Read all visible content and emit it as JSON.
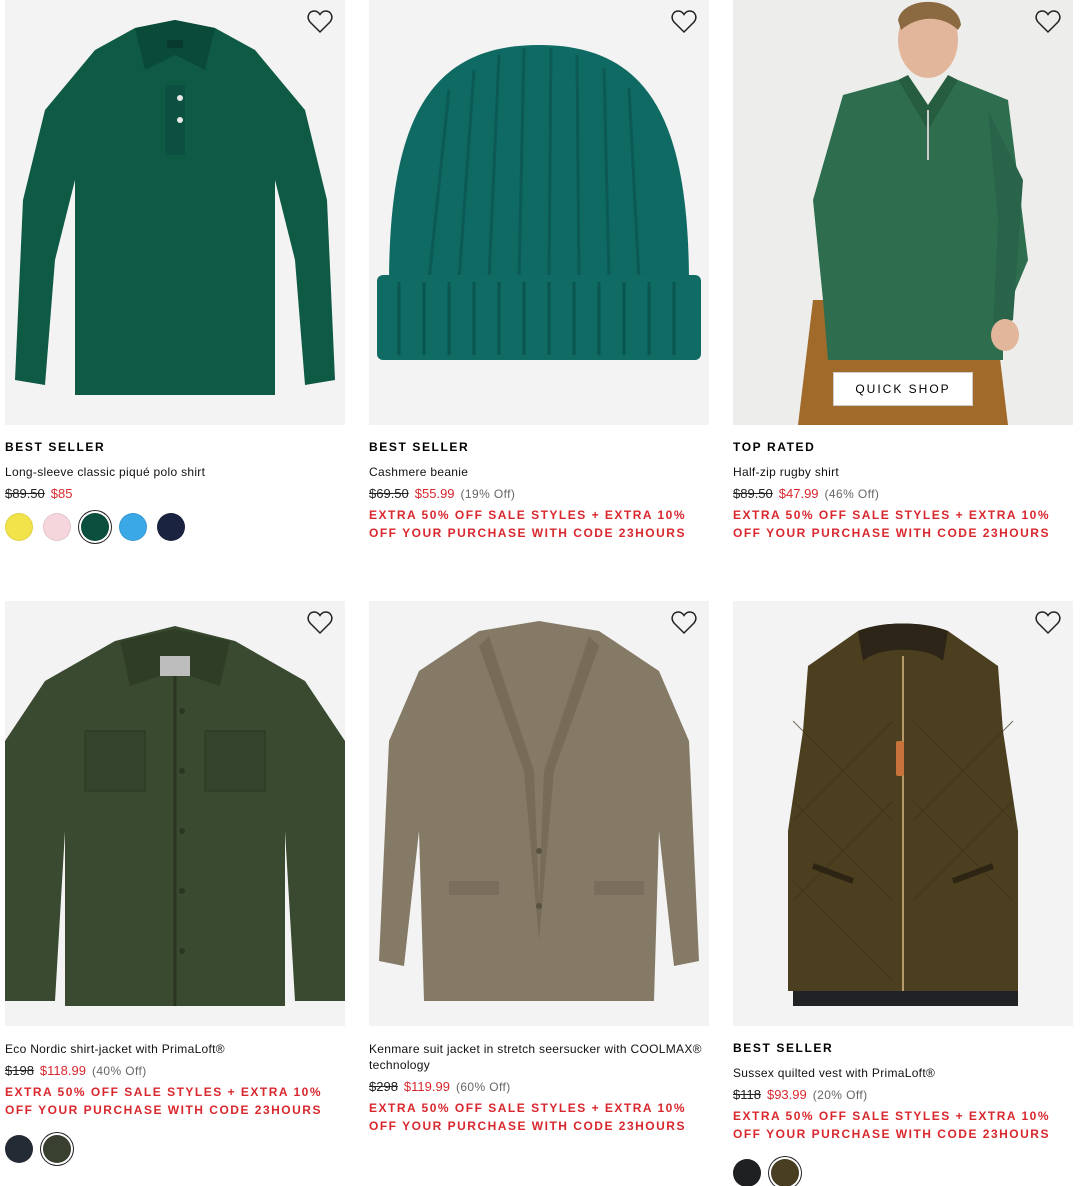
{
  "colors": {
    "sale": "#d9272e",
    "text": "#000000"
  },
  "products": [
    {
      "badge": "BEST SELLER",
      "title": "Long-sleeve classic piqué polo shirt",
      "price_old": "$89.50",
      "price_new": "$85",
      "discount": "",
      "promo": "",
      "swatches": [
        "#f2e34a",
        "#f5d6dc",
        "#0b4f3f",
        "#3aa7e6",
        "#1a2340"
      ],
      "selected_swatch": 2
    },
    {
      "badge": "BEST SELLER",
      "title": "Cashmere beanie",
      "price_old": "$69.50",
      "price_new": "$55.99",
      "discount": "(19% Off)",
      "promo": "EXTRA 50% OFF SALE STYLES + EXTRA 10% OFF YOUR PURCHASE WITH CODE 23HOURS"
    },
    {
      "badge": "TOP RATED",
      "title": "Half-zip rugby shirt",
      "price_old": "$89.50",
      "price_new": "$47.99",
      "discount": "(46% Off)",
      "promo": "EXTRA 50% OFF SALE STYLES + EXTRA 10% OFF YOUR PURCHASE WITH CODE 23HOURS",
      "quick_shop": "QUICK SHOP"
    },
    {
      "badge": "",
      "title": "Eco Nordic shirt-jacket with PrimaLoft®",
      "price_old": "$198",
      "price_new": "$118.99",
      "discount": "(40% Off)",
      "promo": "EXTRA 50% OFF SALE STYLES + EXTRA 10% OFF YOUR PURCHASE WITH CODE 23HOURS",
      "swatches": [
        "#252b35",
        "#3a4030"
      ],
      "selected_swatch": 1
    },
    {
      "badge": "",
      "title": "Kenmare suit jacket in stretch seersucker with COOLMAX® technology",
      "price_old": "$298",
      "price_new": "$119.99",
      "discount": "(60% Off)",
      "promo": "EXTRA 50% OFF SALE STYLES + EXTRA 10% OFF YOUR PURCHASE WITH CODE 23HOURS"
    },
    {
      "badge": "BEST SELLER",
      "title": "Sussex quilted vest with PrimaLoft®",
      "price_old": "$118",
      "price_new": "$93.99",
      "discount": "(20% Off)",
      "promo": "EXTRA 50% OFF SALE STYLES + EXTRA 10% OFF YOUR PURCHASE WITH CODE 23HOURS",
      "swatches": [
        "#1f2022",
        "#4a3e22"
      ],
      "selected_swatch": 1
    }
  ]
}
